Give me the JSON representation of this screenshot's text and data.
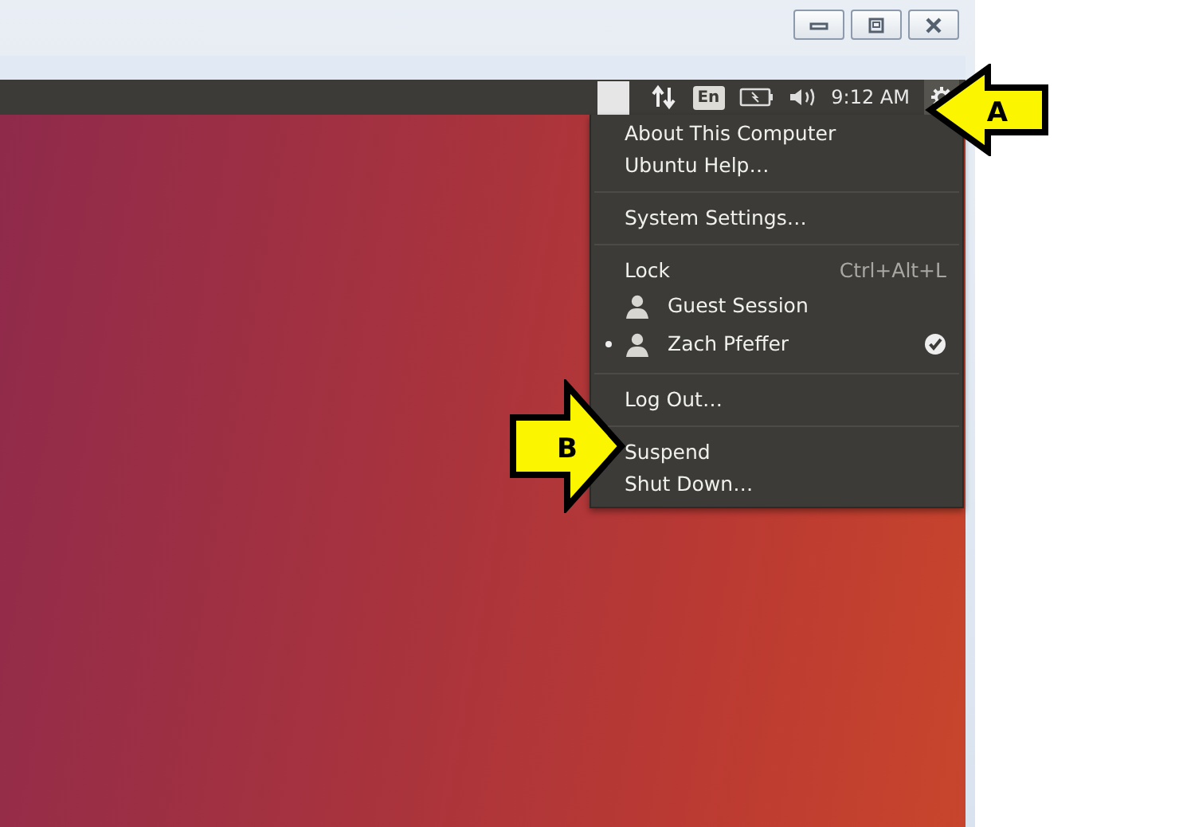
{
  "panel": {
    "keyboard_layout": "En",
    "clock": "9:12 AM"
  },
  "menu": {
    "sections": [
      [
        {
          "kind": "item",
          "label": "About This Computer"
        },
        {
          "kind": "item",
          "label": "Ubuntu Help…"
        }
      ],
      [
        {
          "kind": "item",
          "label": "System Settings…"
        }
      ],
      [
        {
          "kind": "item",
          "label": "Lock",
          "shortcut": "Ctrl+Alt+L"
        },
        {
          "kind": "user",
          "label": "Guest Session",
          "active": false,
          "checked": false
        },
        {
          "kind": "user",
          "label": "Zach Pfeffer",
          "active": true,
          "checked": true
        }
      ],
      [
        {
          "kind": "item",
          "label": "Log Out…"
        }
      ],
      [
        {
          "kind": "item",
          "label": "Suspend"
        },
        {
          "kind": "item",
          "label": "Shut Down…"
        }
      ]
    ]
  },
  "callouts": [
    {
      "label": "A",
      "kind": "left"
    },
    {
      "label": "B",
      "kind": "right"
    }
  ]
}
